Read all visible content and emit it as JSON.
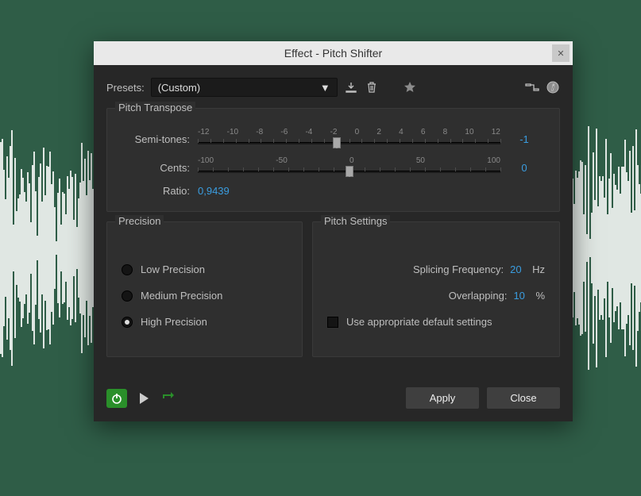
{
  "titlebar": {
    "title": "Effect - Pitch Shifter"
  },
  "presets": {
    "label": "Presets:",
    "value": "(Custom)"
  },
  "pitchTranspose": {
    "title": "Pitch Transpose",
    "semitones": {
      "label": "Semi-tones:",
      "value": "-1",
      "ticks": [
        "-12",
        "-10",
        "-8",
        "-6",
        "-4",
        "-2",
        "0",
        "2",
        "4",
        "6",
        "8",
        "10",
        "12"
      ]
    },
    "cents": {
      "label": "Cents:",
      "value": "0",
      "ticks": [
        "-100",
        "-50",
        "0",
        "50",
        "100"
      ]
    },
    "ratio": {
      "label": "Ratio:",
      "value": "0,9439"
    }
  },
  "precision": {
    "title": "Precision",
    "options": {
      "low": "Low Precision",
      "medium": "Medium Precision",
      "high": "High Precision"
    },
    "selected": "high"
  },
  "pitchSettings": {
    "title": "Pitch Settings",
    "splicing": {
      "label": "Splicing Frequency:",
      "value": "20",
      "unit": "Hz"
    },
    "overlapping": {
      "label": "Overlapping:",
      "value": "10",
      "unit": "%"
    },
    "defaults": "Use appropriate default settings"
  },
  "footer": {
    "apply": "Apply",
    "close": "Close"
  }
}
